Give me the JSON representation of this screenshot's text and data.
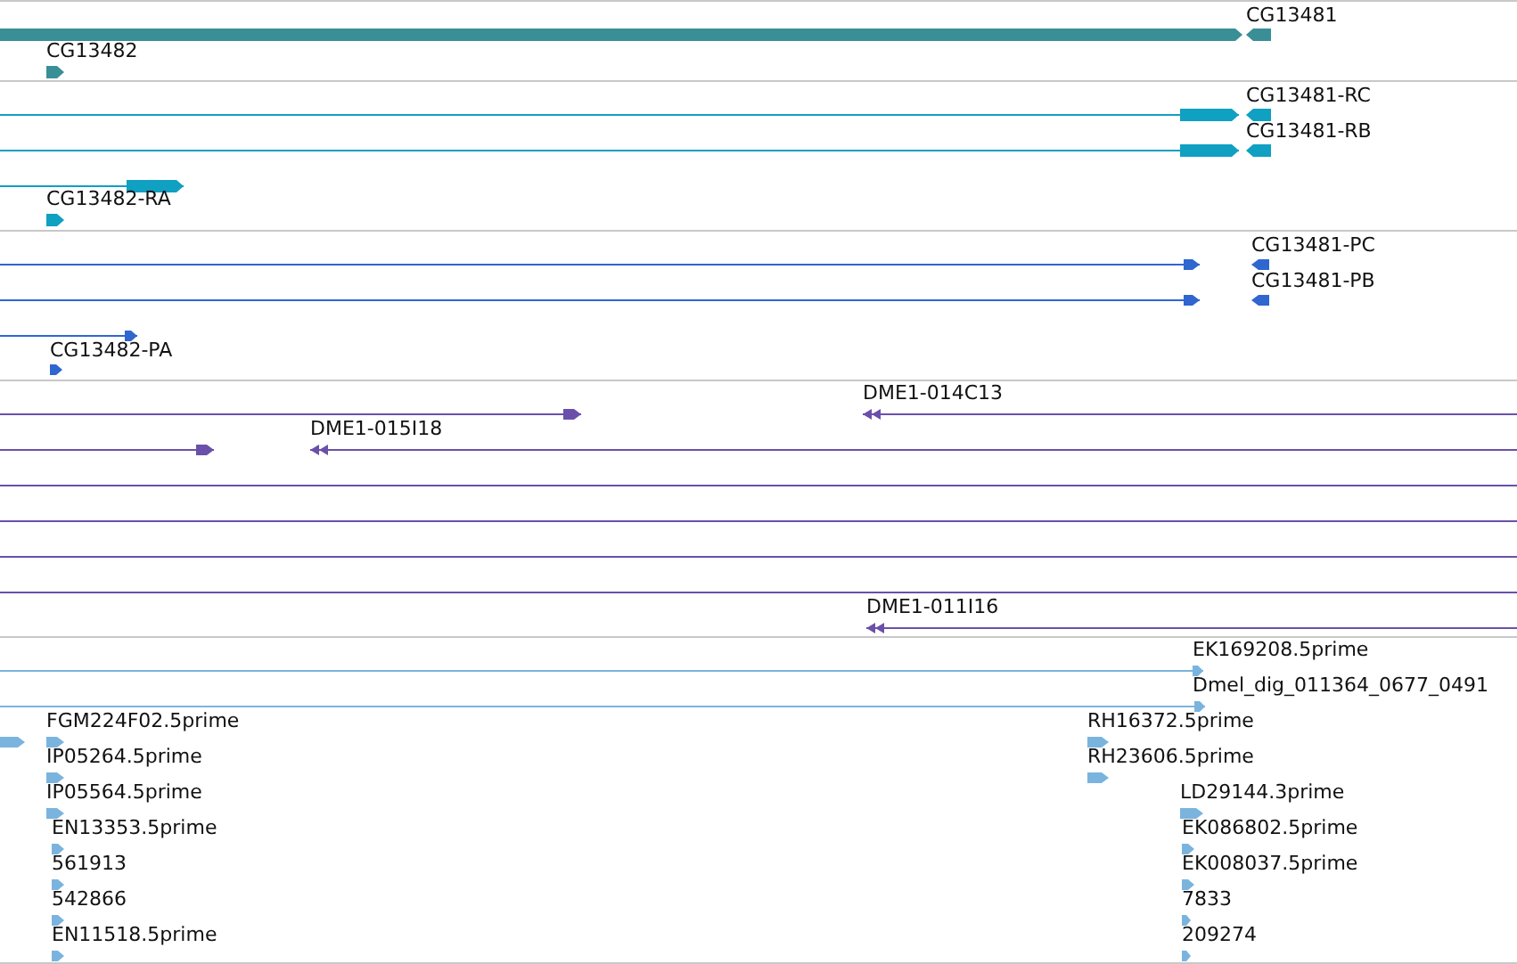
{
  "tracks": [
    {
      "kind": "gene",
      "features": [
        {
          "reverse": false
        },
        {
          "label": "CG13481",
          "reverse": true
        },
        {
          "label": "CG13482",
          "reverse": false
        }
      ]
    },
    {
      "kind": "transcript",
      "features": [
        {
          "reverse": false
        },
        {
          "label": "CG13481-RC",
          "reverse": true
        },
        {
          "reverse": false
        },
        {
          "label": "CG13481-RB",
          "reverse": true
        },
        {
          "reverse": false
        },
        {
          "label": "CG13482-RA",
          "reverse": false
        }
      ]
    },
    {
      "kind": "protein",
      "features": [
        {
          "reverse": false
        },
        {
          "label": "CG13481-PC",
          "reverse": true
        },
        {
          "reverse": false
        },
        {
          "label": "CG13481-PB",
          "reverse": true
        },
        {
          "reverse": false
        },
        {
          "label": "CG13482-PA",
          "reverse": false
        }
      ]
    },
    {
      "kind": "clone",
      "features": [
        {
          "kind": "arrow",
          "reverse": false
        },
        {
          "kind": "arrow",
          "label": "DME1-014C13",
          "reverse": true
        },
        {
          "kind": "arrow",
          "reverse": false
        },
        {
          "kind": "arrow",
          "label": "DME1-015I18",
          "reverse": true
        },
        {
          "kind": "line"
        },
        {
          "kind": "line"
        },
        {
          "kind": "line"
        },
        {
          "kind": "line"
        },
        {
          "kind": "arrow",
          "label": "DME1-011I16",
          "reverse": true
        }
      ]
    },
    {
      "kind": "est",
      "features": [
        {
          "label": "EK169208.5prime",
          "reverse": false
        },
        {
          "label": "Dmel_dig_011364_0677_0491",
          "reverse": false
        },
        {
          "reverse": false
        },
        {
          "label": "FGM224F02.5prime",
          "reverse": false
        },
        {
          "label": "IP05264.5prime",
          "reverse": false
        },
        {
          "label": "IP05564.5prime",
          "reverse": false
        },
        {
          "label": "EN13353.5prime",
          "reverse": false
        },
        {
          "label": "561913",
          "reverse": false
        },
        {
          "label": "542866",
          "reverse": false
        },
        {
          "label": "EN11518.5prime",
          "reverse": false
        },
        {
          "label": "RH16372.5prime",
          "reverse": false
        },
        {
          "label": "RH23606.5prime",
          "reverse": false
        },
        {
          "label": "LD29144.3prime",
          "reverse": false
        },
        {
          "label": "EK086802.5prime",
          "reverse": false
        },
        {
          "label": "EK008037.5prime",
          "reverse": false
        },
        {
          "label": "7833",
          "reverse": false
        },
        {
          "label": "209274",
          "reverse": false
        }
      ]
    }
  ]
}
